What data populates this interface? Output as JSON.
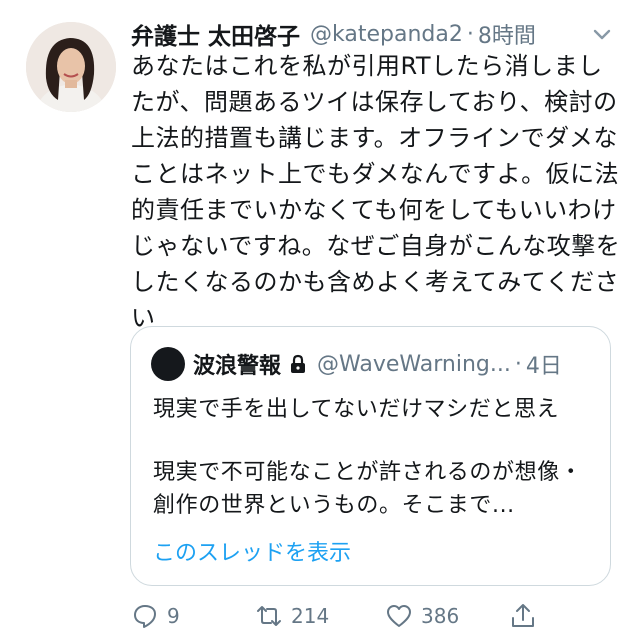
{
  "tweet": {
    "author_name": "弁護士 太田啓子",
    "handle": "@katepanda2",
    "dot": "·",
    "time": "8時間",
    "text": "あなたはこれを私が引用RTしたら消しましたが、問題あるツイは保存しており、検討の上法的措置も講じます。オフラインでダメなことはネット上でもダメなんですよ。仮に法的責任までいかなくても何をしてもいいわけじゃないですね。なぜご自身がこんな攻撃をしたくなるのかも含めよく考えてみてください"
  },
  "quote": {
    "author_name": "波浪警報",
    "handle": "@WaveWarning...",
    "dot": "·",
    "time": "4日",
    "line1": "現実で手を出してないだけマシだと思え",
    "line2": "現実で不可能なことが許されるのが想像・創作の世界というもの。そこまで...",
    "show_thread": "このスレッドを表示"
  },
  "actions": {
    "replies": "9",
    "retweets": "214",
    "likes": "386"
  },
  "icons": {
    "reply": "reply-icon",
    "retweet": "retweet-icon",
    "like": "heart-icon",
    "share": "share-icon",
    "lock": "lock-icon",
    "caret": "chevron-down-icon"
  },
  "colors": {
    "link": "#1da1f2",
    "secondary_text": "#657786",
    "border": "#cfd9de"
  }
}
